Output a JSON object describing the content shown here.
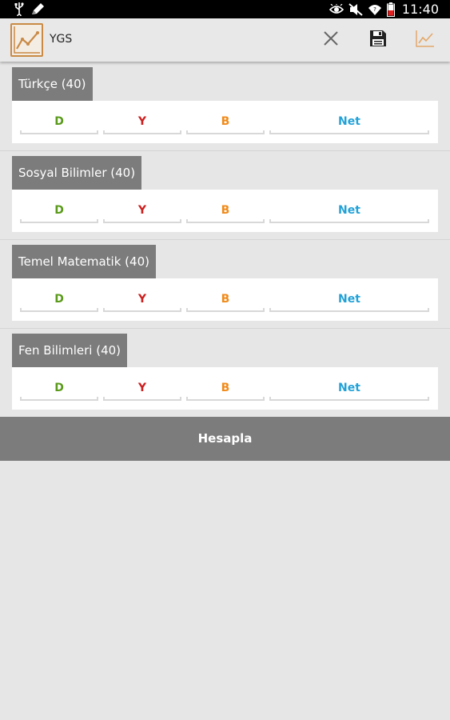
{
  "status_bar": {
    "time": "11:40",
    "icons": [
      "usb-icon",
      "pencil-icon",
      "eye-icon",
      "mute-icon",
      "wifi-icon",
      "battery-icon"
    ]
  },
  "action_bar": {
    "title": "YGS",
    "accent": "#c98a45",
    "actions": [
      "close-icon",
      "save-icon",
      "chart-icon"
    ]
  },
  "sections": [
    {
      "title": "Türkçe (40)",
      "d": "D",
      "y": "Y",
      "b": "B",
      "net": "Net"
    },
    {
      "title": "Sosyal Bilimler (40)",
      "d": "D",
      "y": "Y",
      "b": "B",
      "net": "Net"
    },
    {
      "title": "Temel Matematik (40)",
      "d": "D",
      "y": "Y",
      "b": "B",
      "net": "Net"
    },
    {
      "title": "Fen Bilimleri (40)",
      "d": "D",
      "y": "Y",
      "b": "B",
      "net": "Net"
    }
  ],
  "calculate_label": "Hesapla",
  "colors": {
    "d": "#5a9a1a",
    "y": "#cc1f1f",
    "b": "#f08a1a",
    "net": "#23a2d8",
    "header_bg": "#7c7c7c"
  }
}
